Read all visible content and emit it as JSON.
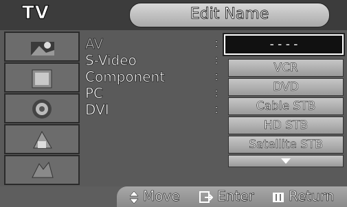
{
  "header": {
    "left_title": "TV",
    "title": "Edit Name"
  },
  "sources": [
    {
      "label": "AV",
      "selected": true
    },
    {
      "label": "S-Video",
      "selected": false
    },
    {
      "label": "Component",
      "selected": false
    },
    {
      "label": "PC",
      "selected": false
    },
    {
      "label": "DVI",
      "selected": false
    }
  ],
  "separator": ":",
  "name_input": {
    "value": "- - - -"
  },
  "options": [
    "VCR",
    "DVD",
    "Cable STB",
    "HD STB",
    "Satellite STB"
  ],
  "footer": {
    "move": "Move",
    "enter": "Enter",
    "return": "Return"
  },
  "icons": [
    "picture-icon",
    "sound-icon",
    "channel-icon",
    "setup-icon",
    "input-icon"
  ]
}
